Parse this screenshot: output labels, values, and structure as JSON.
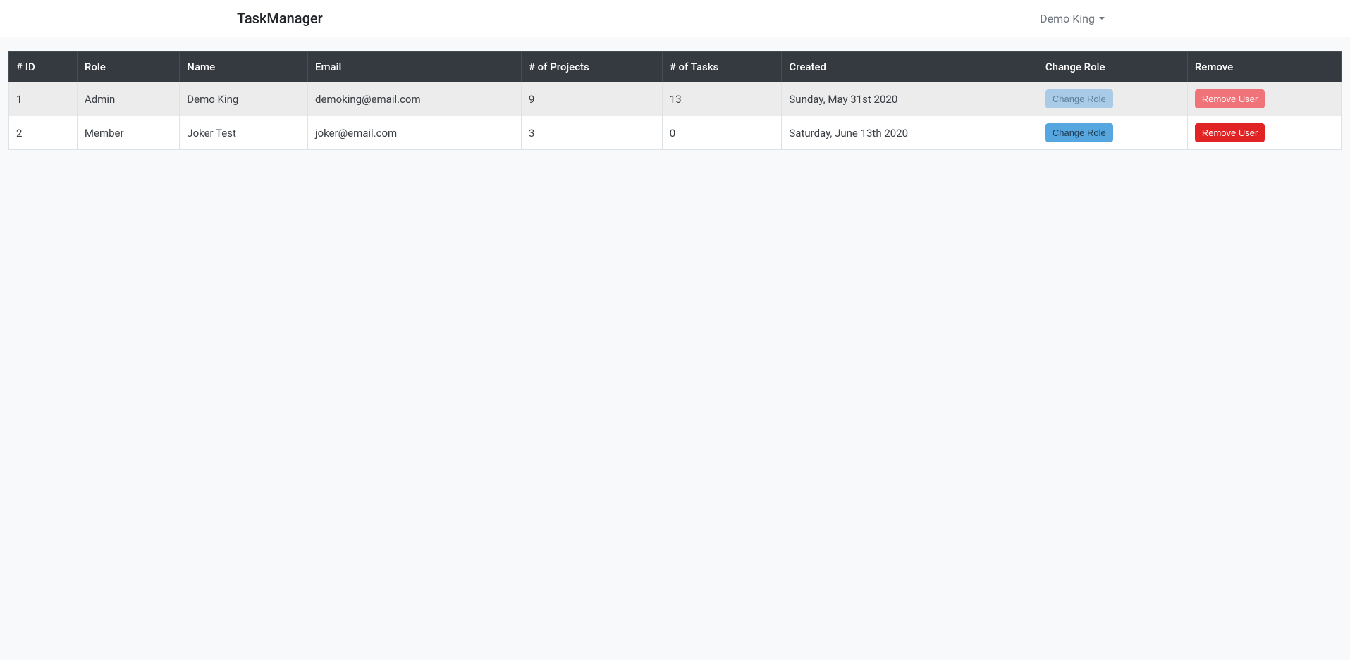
{
  "navbar": {
    "brand": "TaskManager",
    "user_name": "Demo King"
  },
  "table": {
    "headers": {
      "id": "# ID",
      "role": "Role",
      "name": "Name",
      "email": "Email",
      "projects": "# of Projects",
      "tasks": "# of Tasks",
      "created": "Created",
      "change_role": "Change Role",
      "remove": "Remove"
    },
    "rows": [
      {
        "id": "1",
        "role": "Admin",
        "name": "Demo King",
        "email": "demoking@email.com",
        "projects": "9",
        "tasks": "13",
        "created": "Sunday, May 31st 2020",
        "change_label": "Change Role",
        "remove_label": "Remove User",
        "change_disabled": true,
        "remove_disabled": true
      },
      {
        "id": "2",
        "role": "Member",
        "name": "Joker Test",
        "email": "joker@email.com",
        "projects": "3",
        "tasks": "0",
        "created": "Saturday, June 13th 2020",
        "change_label": "Change Role",
        "remove_label": "Remove User",
        "change_disabled": false,
        "remove_disabled": false
      }
    ]
  }
}
